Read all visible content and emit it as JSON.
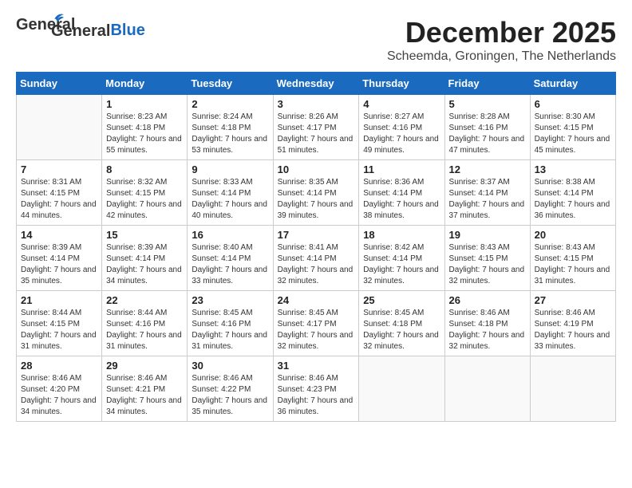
{
  "logo": {
    "line1": "General",
    "line2": "Blue"
  },
  "title": "December 2025",
  "location": "Scheemda, Groningen, The Netherlands",
  "weekdays": [
    "Sunday",
    "Monday",
    "Tuesday",
    "Wednesday",
    "Thursday",
    "Friday",
    "Saturday"
  ],
  "weeks": [
    [
      {
        "day": "",
        "sunrise": "",
        "sunset": "",
        "daylight": ""
      },
      {
        "day": "1",
        "sunrise": "Sunrise: 8:23 AM",
        "sunset": "Sunset: 4:18 PM",
        "daylight": "Daylight: 7 hours and 55 minutes."
      },
      {
        "day": "2",
        "sunrise": "Sunrise: 8:24 AM",
        "sunset": "Sunset: 4:18 PM",
        "daylight": "Daylight: 7 hours and 53 minutes."
      },
      {
        "day": "3",
        "sunrise": "Sunrise: 8:26 AM",
        "sunset": "Sunset: 4:17 PM",
        "daylight": "Daylight: 7 hours and 51 minutes."
      },
      {
        "day": "4",
        "sunrise": "Sunrise: 8:27 AM",
        "sunset": "Sunset: 4:16 PM",
        "daylight": "Daylight: 7 hours and 49 minutes."
      },
      {
        "day": "5",
        "sunrise": "Sunrise: 8:28 AM",
        "sunset": "Sunset: 4:16 PM",
        "daylight": "Daylight: 7 hours and 47 minutes."
      },
      {
        "day": "6",
        "sunrise": "Sunrise: 8:30 AM",
        "sunset": "Sunset: 4:15 PM",
        "daylight": "Daylight: 7 hours and 45 minutes."
      }
    ],
    [
      {
        "day": "7",
        "sunrise": "Sunrise: 8:31 AM",
        "sunset": "Sunset: 4:15 PM",
        "daylight": "Daylight: 7 hours and 44 minutes."
      },
      {
        "day": "8",
        "sunrise": "Sunrise: 8:32 AM",
        "sunset": "Sunset: 4:15 PM",
        "daylight": "Daylight: 7 hours and 42 minutes."
      },
      {
        "day": "9",
        "sunrise": "Sunrise: 8:33 AM",
        "sunset": "Sunset: 4:14 PM",
        "daylight": "Daylight: 7 hours and 40 minutes."
      },
      {
        "day": "10",
        "sunrise": "Sunrise: 8:35 AM",
        "sunset": "Sunset: 4:14 PM",
        "daylight": "Daylight: 7 hours and 39 minutes."
      },
      {
        "day": "11",
        "sunrise": "Sunrise: 8:36 AM",
        "sunset": "Sunset: 4:14 PM",
        "daylight": "Daylight: 7 hours and 38 minutes."
      },
      {
        "day": "12",
        "sunrise": "Sunrise: 8:37 AM",
        "sunset": "Sunset: 4:14 PM",
        "daylight": "Daylight: 7 hours and 37 minutes."
      },
      {
        "day": "13",
        "sunrise": "Sunrise: 8:38 AM",
        "sunset": "Sunset: 4:14 PM",
        "daylight": "Daylight: 7 hours and 36 minutes."
      }
    ],
    [
      {
        "day": "14",
        "sunrise": "Sunrise: 8:39 AM",
        "sunset": "Sunset: 4:14 PM",
        "daylight": "Daylight: 7 hours and 35 minutes."
      },
      {
        "day": "15",
        "sunrise": "Sunrise: 8:39 AM",
        "sunset": "Sunset: 4:14 PM",
        "daylight": "Daylight: 7 hours and 34 minutes."
      },
      {
        "day": "16",
        "sunrise": "Sunrise: 8:40 AM",
        "sunset": "Sunset: 4:14 PM",
        "daylight": "Daylight: 7 hours and 33 minutes."
      },
      {
        "day": "17",
        "sunrise": "Sunrise: 8:41 AM",
        "sunset": "Sunset: 4:14 PM",
        "daylight": "Daylight: 7 hours and 32 minutes."
      },
      {
        "day": "18",
        "sunrise": "Sunrise: 8:42 AM",
        "sunset": "Sunset: 4:14 PM",
        "daylight": "Daylight: 7 hours and 32 minutes."
      },
      {
        "day": "19",
        "sunrise": "Sunrise: 8:43 AM",
        "sunset": "Sunset: 4:15 PM",
        "daylight": "Daylight: 7 hours and 32 minutes."
      },
      {
        "day": "20",
        "sunrise": "Sunrise: 8:43 AM",
        "sunset": "Sunset: 4:15 PM",
        "daylight": "Daylight: 7 hours and 31 minutes."
      }
    ],
    [
      {
        "day": "21",
        "sunrise": "Sunrise: 8:44 AM",
        "sunset": "Sunset: 4:15 PM",
        "daylight": "Daylight: 7 hours and 31 minutes."
      },
      {
        "day": "22",
        "sunrise": "Sunrise: 8:44 AM",
        "sunset": "Sunset: 4:16 PM",
        "daylight": "Daylight: 7 hours and 31 minutes."
      },
      {
        "day": "23",
        "sunrise": "Sunrise: 8:45 AM",
        "sunset": "Sunset: 4:16 PM",
        "daylight": "Daylight: 7 hours and 31 minutes."
      },
      {
        "day": "24",
        "sunrise": "Sunrise: 8:45 AM",
        "sunset": "Sunset: 4:17 PM",
        "daylight": "Daylight: 7 hours and 32 minutes."
      },
      {
        "day": "25",
        "sunrise": "Sunrise: 8:45 AM",
        "sunset": "Sunset: 4:18 PM",
        "daylight": "Daylight: 7 hours and 32 minutes."
      },
      {
        "day": "26",
        "sunrise": "Sunrise: 8:46 AM",
        "sunset": "Sunset: 4:18 PM",
        "daylight": "Daylight: 7 hours and 32 minutes."
      },
      {
        "day": "27",
        "sunrise": "Sunrise: 8:46 AM",
        "sunset": "Sunset: 4:19 PM",
        "daylight": "Daylight: 7 hours and 33 minutes."
      }
    ],
    [
      {
        "day": "28",
        "sunrise": "Sunrise: 8:46 AM",
        "sunset": "Sunset: 4:20 PM",
        "daylight": "Daylight: 7 hours and 34 minutes."
      },
      {
        "day": "29",
        "sunrise": "Sunrise: 8:46 AM",
        "sunset": "Sunset: 4:21 PM",
        "daylight": "Daylight: 7 hours and 34 minutes."
      },
      {
        "day": "30",
        "sunrise": "Sunrise: 8:46 AM",
        "sunset": "Sunset: 4:22 PM",
        "daylight": "Daylight: 7 hours and 35 minutes."
      },
      {
        "day": "31",
        "sunrise": "Sunrise: 8:46 AM",
        "sunset": "Sunset: 4:23 PM",
        "daylight": "Daylight: 7 hours and 36 minutes."
      },
      {
        "day": "",
        "sunrise": "",
        "sunset": "",
        "daylight": ""
      },
      {
        "day": "",
        "sunrise": "",
        "sunset": "",
        "daylight": ""
      },
      {
        "day": "",
        "sunrise": "",
        "sunset": "",
        "daylight": ""
      }
    ]
  ]
}
